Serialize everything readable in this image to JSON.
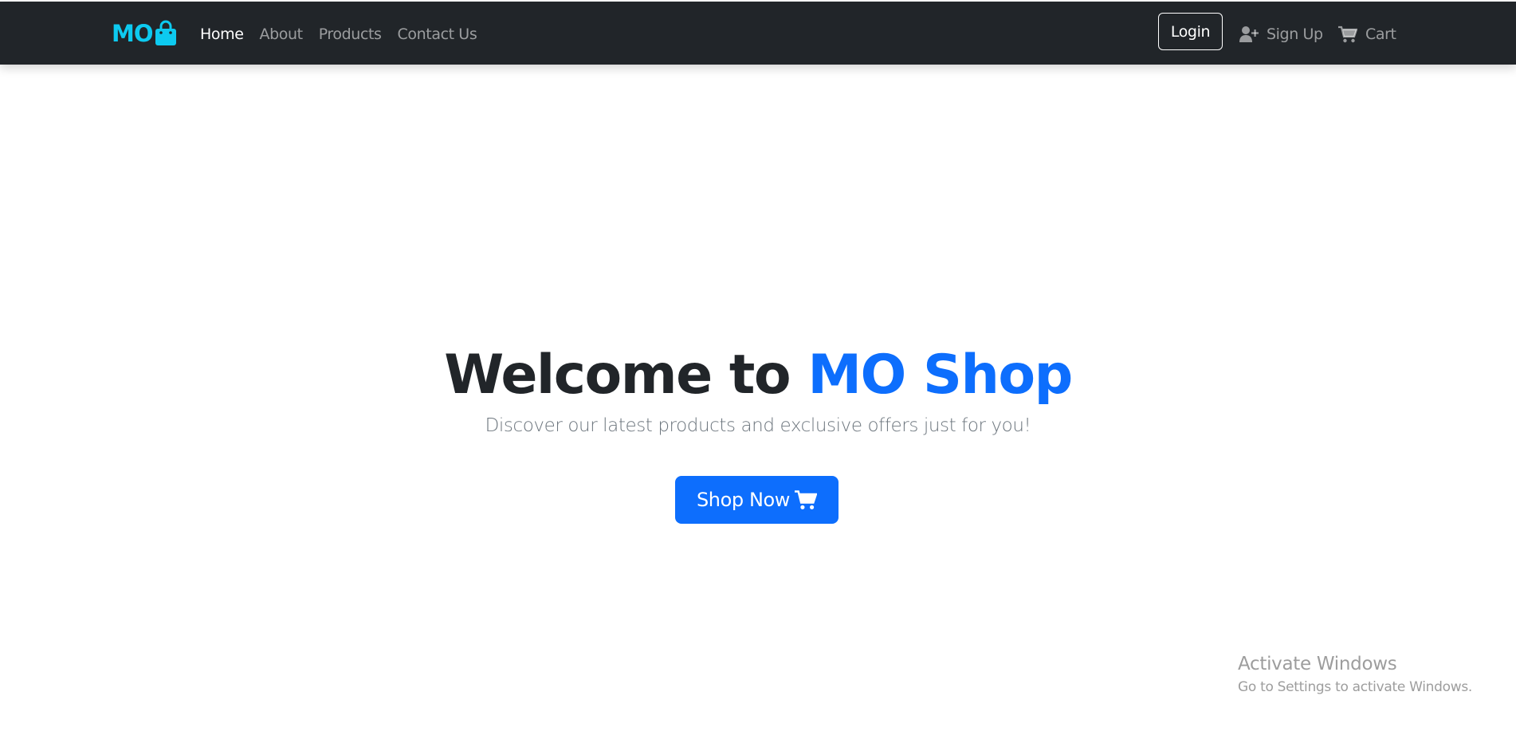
{
  "navbar": {
    "brand": {
      "text": "MO",
      "icon": "shopping-bag-icon"
    },
    "links": [
      {
        "label": "Home",
        "active": true
      },
      {
        "label": "About",
        "active": false
      },
      {
        "label": "Products",
        "active": false
      },
      {
        "label": "Contact Us",
        "active": false
      }
    ],
    "login_label": "Login",
    "signup_label": "Sign Up",
    "signup_icon": "user-plus-icon",
    "cart_label": "Cart",
    "cart_icon": "cart-icon"
  },
  "hero": {
    "title_prefix": "Welcome to",
    "title_accent": "MO Shop",
    "subtitle": "Discover our latest products and exclusive offers just for you!",
    "cta_label": "Shop Now",
    "cta_icon": "cart-icon"
  },
  "watermark": {
    "title": "Activate Windows",
    "subtitle": "Go to Settings to activate Windows."
  },
  "colors": {
    "navbar_bg": "#212529",
    "brand": "#0dcaf0",
    "accent": "#0d6efd",
    "text_dark": "#212529",
    "text_muted": "#6c757d"
  }
}
